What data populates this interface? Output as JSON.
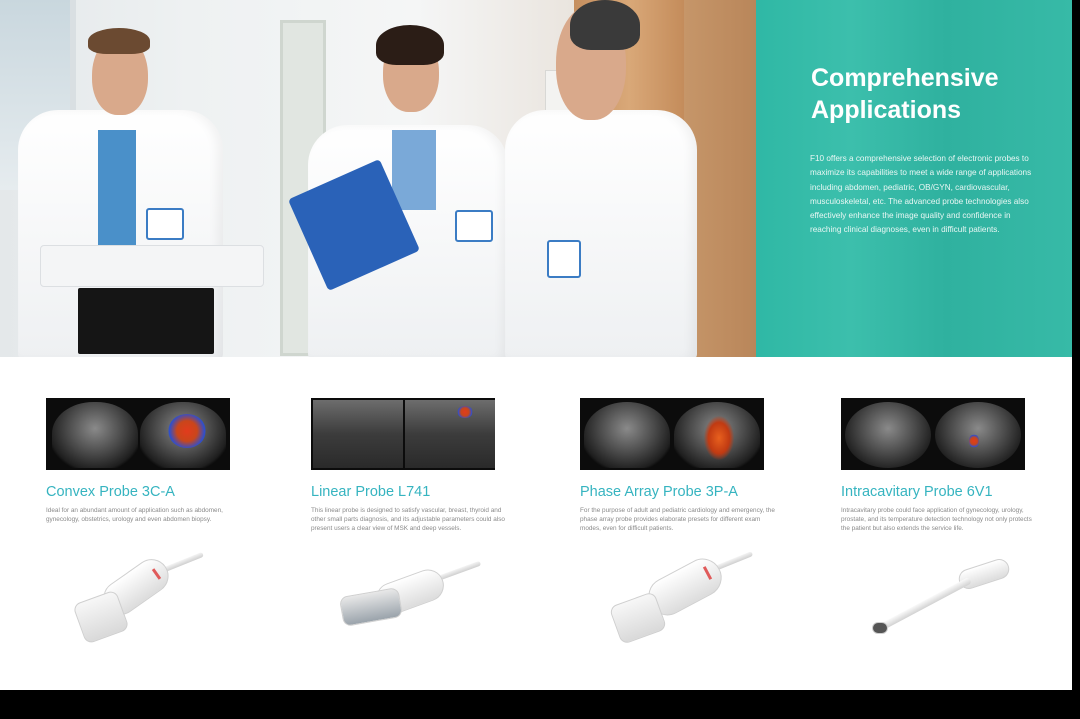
{
  "hero": {
    "title_line1": "Comprehensive",
    "title_line2": "Applications",
    "body": "F10 offers a comprehensive selection of electronic probes to maximize its capabilities to meet a wide range of applications including abdomen, pediatric, OB/GYN, cardiovascular, musculoskeletal, etc. The advanced probe technologies also effectively enhance the image quality and confidence in reaching clinical diagnoses, even in difficult patients."
  },
  "colors": {
    "teal": "#2fb8a5",
    "probe_title": "#36b4c0"
  },
  "probes": [
    {
      "title": "Convex Probe 3C-A",
      "desc": "Ideal for an abundant amount of application such as abdomen, gynecology, obstetrics, urology and even abdomen biopsy."
    },
    {
      "title": "Linear Probe L741",
      "desc": "This linear probe is designed to satisfy vascular, breast, thyroid and other small parts diagnosis, and its adjustable parameters could also present users a clear view of MSK and deep vessels."
    },
    {
      "title": "Phase Array Probe 3P-A",
      "desc": "For the purpose of adult and pediatric cardiology and emergency, the phase array probe provides elaborate presets for different exam modes, even for difficult patients."
    },
    {
      "title": "Intracavitary Probe 6V1",
      "desc": "Intracavitary probe could face application of gynecology, urology, prostate, and its temperature detection technology not only protects the patient but also extends the service life."
    }
  ]
}
